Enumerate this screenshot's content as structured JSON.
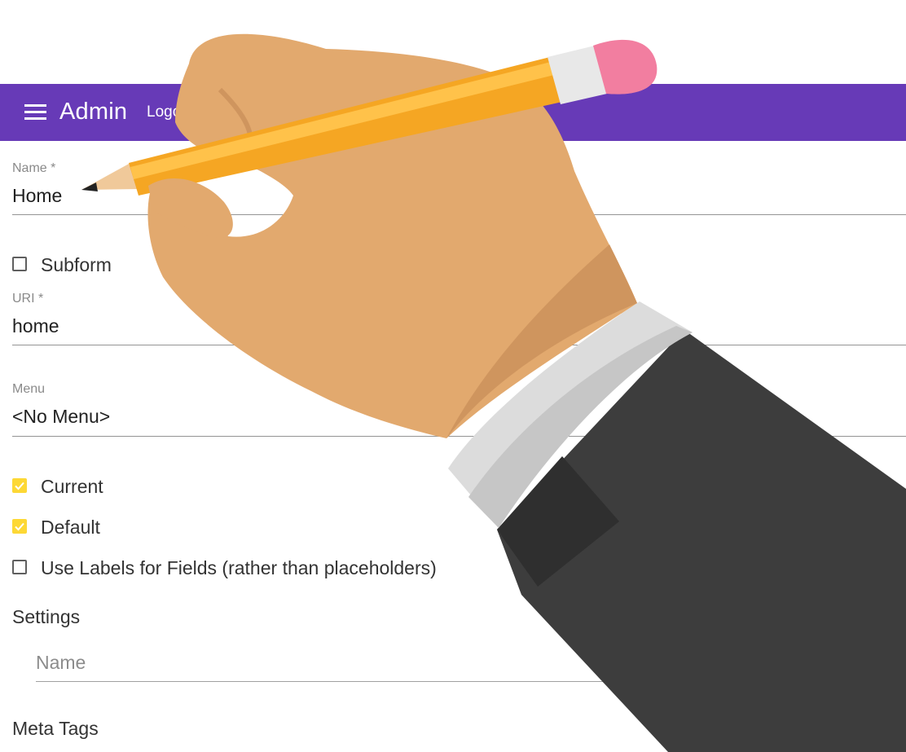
{
  "colors": {
    "app_bar": "#673ab7",
    "checkbox_checked": "#fdd835",
    "hand_skin": "#e2a96e",
    "pencil": "#f5a623",
    "eraser": "#f27ea0",
    "sleeve": "#3d3d3d"
  },
  "app_bar": {
    "menu_icon": "menu-icon",
    "title": "Admin",
    "logout_label": "Logo"
  },
  "form": {
    "name": {
      "label": "Name *",
      "value": "Home"
    },
    "subform": {
      "label": "Subform",
      "checked": false
    },
    "uri": {
      "label": "URI *",
      "value": "home"
    },
    "menu": {
      "label": "Menu",
      "value": "<No Menu>"
    },
    "current": {
      "label": "Current",
      "checked": true
    },
    "default": {
      "label": "Default",
      "checked": true
    },
    "use_labels": {
      "label": "Use Labels for Fields (rather than placeholders)",
      "checked": false
    },
    "settings": {
      "heading": "Settings",
      "name_placeholder": "Name"
    },
    "meta_tags": {
      "heading": "Meta Tags"
    }
  },
  "overlay": {
    "illustration": "hand-holding-pencil"
  }
}
